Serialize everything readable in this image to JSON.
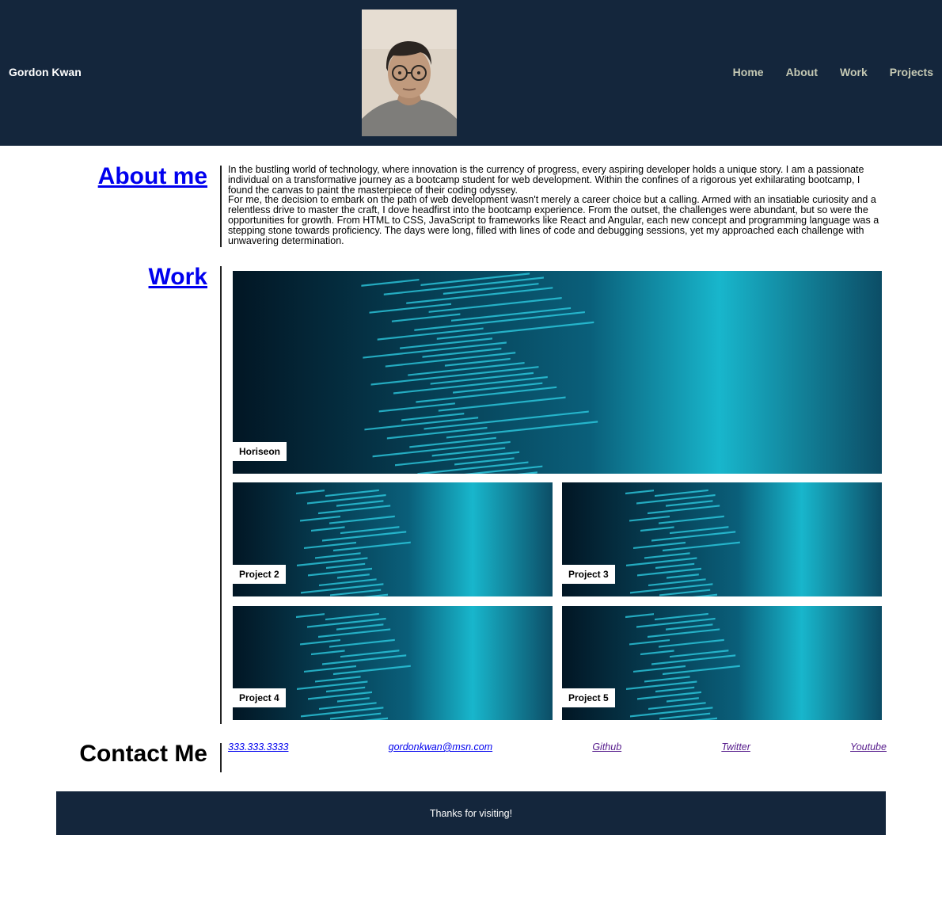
{
  "header": {
    "brand": "Gordon Kwan",
    "nav": [
      {
        "label": "Home"
      },
      {
        "label": "About"
      },
      {
        "label": "Work"
      },
      {
        "label": "Projects"
      }
    ]
  },
  "about": {
    "title": "About me",
    "paragraphs": [
      "In the bustling world of technology, where innovation is the currency of progress, every aspiring developer holds a unique story. I am a passionate individual on a transformative journey as a bootcamp student for web development. Within the confines of a rigorous yet exhilarating bootcamp, I found the canvas to paint the masterpiece of their coding odyssey.",
      "For me, the decision to embark on the path of web development wasn't merely a career choice but a calling. Armed with an insatiable curiosity and a relentless drive to master the craft, I dove headfirst into the bootcamp experience. From the outset, the challenges were abundant, but so were the opportunities for growth. From HTML to CSS, JavaScript to frameworks like React and Angular, each new concept and programming language was a stepping stone towards proficiency. The days were long, filled with lines of code and debugging sessions, yet my approached each challenge with unwavering determination."
    ]
  },
  "work": {
    "title": "Work",
    "projects": [
      {
        "label": "Horiseon"
      },
      {
        "label": "Project 2"
      },
      {
        "label": "Project 3"
      },
      {
        "label": "Project 4"
      },
      {
        "label": "Project 5"
      }
    ]
  },
  "contact": {
    "title": "Contact Me",
    "links": [
      {
        "label": "333.333.3333"
      },
      {
        "label": "gordonkwan@msn.com"
      },
      {
        "label": "Github"
      },
      {
        "label": "Twitter"
      },
      {
        "label": "Youtube"
      }
    ]
  },
  "footer": {
    "text": "Thanks for visiting!"
  },
  "colors": {
    "header_bg": "#14263c",
    "nav_text": "#c5c9b4",
    "link": "#0000ee",
    "visited_link": "#551a8b",
    "code_cyan": "#2fd3e8"
  }
}
